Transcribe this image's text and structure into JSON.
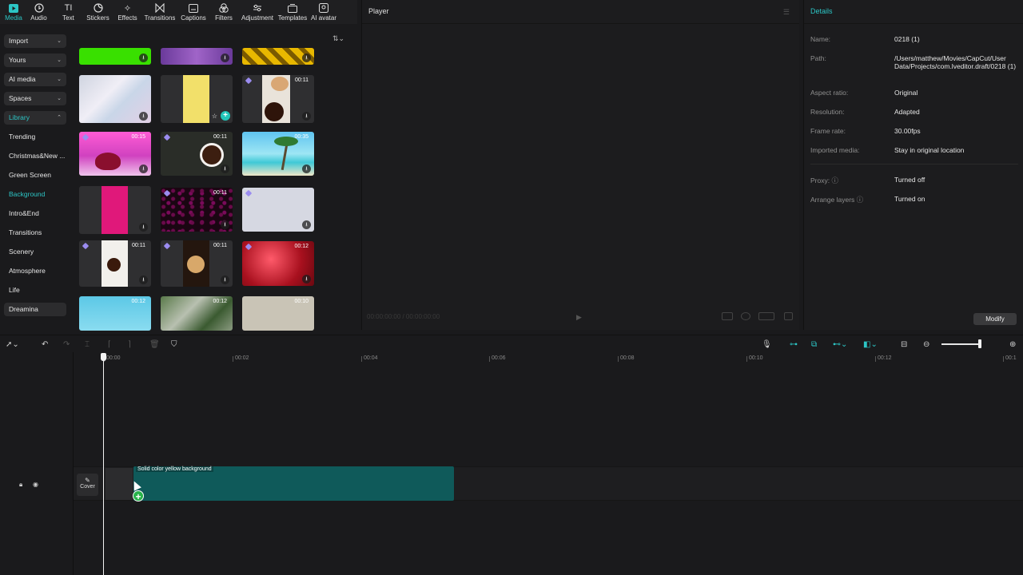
{
  "toolbar": {
    "tools": [
      {
        "label": "Media",
        "icon": "media-icon"
      },
      {
        "label": "Audio",
        "icon": "audio-icon"
      },
      {
        "label": "Text",
        "icon": "text-icon"
      },
      {
        "label": "Stickers",
        "icon": "stickers-icon"
      },
      {
        "label": "Effects",
        "icon": "effects-icon"
      },
      {
        "label": "Transitions",
        "icon": "transitions-icon"
      },
      {
        "label": "Captions",
        "icon": "captions-icon"
      },
      {
        "label": "Filters",
        "icon": "filters-icon"
      },
      {
        "label": "Adjustment",
        "icon": "adjustment-icon"
      },
      {
        "label": "Templates",
        "icon": "templates-icon"
      },
      {
        "label": "AI avatar",
        "icon": "ai-avatar-icon"
      }
    ]
  },
  "leftnav": {
    "groups": [
      "Import",
      "Yours",
      "AI media",
      "Spaces",
      "Library"
    ],
    "items": [
      "Trending",
      "Christmas&New ...",
      "Green Screen",
      "Background",
      "Intro&End",
      "Transitions",
      "Scenery",
      "Atmosphere",
      "Life",
      "Dreamina"
    ]
  },
  "grid": {
    "thumbs": [
      {
        "dur": ""
      },
      {
        "dur": ""
      },
      {
        "dur": ""
      },
      {
        "dur": ""
      },
      {
        "dur": ""
      },
      {
        "dur": "00:11"
      },
      {
        "dur": "00:15"
      },
      {
        "dur": "00:11"
      },
      {
        "dur": "00:35"
      },
      {
        "dur": ""
      },
      {
        "dur": "00:11"
      },
      {
        "dur": ""
      },
      {
        "dur": "00:11"
      },
      {
        "dur": "00:11"
      },
      {
        "dur": "00:12"
      },
      {
        "dur": "00:12"
      },
      {
        "dur": "00:12"
      },
      {
        "dur": "00:10"
      }
    ]
  },
  "player": {
    "title": "Player",
    "timecode": "00:00:00:00 / 00:00:00:00"
  },
  "details": {
    "title": "Details",
    "rows": [
      {
        "k": "Name:",
        "v": "0218 (1)"
      },
      {
        "k": "Path:",
        "v": "/Users/matthew/Movies/CapCut/User Data/Projects/com.lveditor.draft/0218 (1)"
      },
      {
        "k": "Aspect ratio:",
        "v": "Original"
      },
      {
        "k": "Resolution:",
        "v": "Adapted"
      },
      {
        "k": "Frame rate:",
        "v": "30.00fps"
      },
      {
        "k": "Imported media:",
        "v": "Stay in original location"
      },
      {
        "k": "Proxy: ⓘ",
        "v": "Turned off"
      },
      {
        "k": "Arrange layers ⓘ",
        "v": "Turned on"
      }
    ],
    "modify_label": "Modify"
  },
  "timeline": {
    "ticks": [
      "00:00",
      "00:02",
      "00:04",
      "00:06",
      "00:08",
      "00:10",
      "00:12",
      "00:1"
    ],
    "cover_label": "Cover",
    "clip_label": "Solid color yellow background",
    "zoom_level": 0.95
  }
}
